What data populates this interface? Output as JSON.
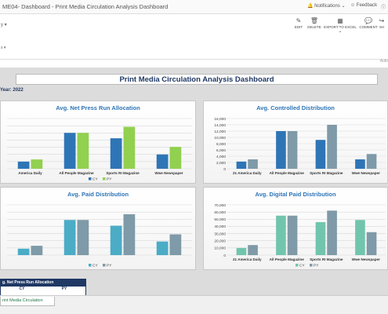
{
  "window": {
    "title": "ME04- Dashboard - Print Media Circulation Analysis Dashboard",
    "notifications": "Notifications",
    "feedback": "Feedback"
  },
  "toolbar": {
    "edit": "EDIT",
    "delete": "DELETE",
    "export": "EXPORT TO EXCEL",
    "comment": "COMMENT",
    "share": "SH",
    "select_left": "y",
    "select_left2": "s",
    "auto": "Auto"
  },
  "dashboard": {
    "title": "Print Media Circulation Analysis Dashboard",
    "year_label": "Year:",
    "year_value": "2022"
  },
  "colors": {
    "banner_text": "#1f3864",
    "panel_title": "#2e75b6",
    "gray_bg": "#dcdcdc"
  },
  "chart_data": [
    {
      "type": "bar",
      "title": "Avg. Net Press Run Allocation",
      "categories": [
        "America Daily",
        "All People Magazine",
        "Sports RI Magazine",
        "Wwe Newspaper"
      ],
      "series": [
        {
          "name": "CY",
          "color": "#2e75b6",
          "values": [
            2,
            10,
            8.5,
            4
          ]
        },
        {
          "name": "PY",
          "color": "#92d050",
          "values": [
            2.6,
            10,
            11.7,
            6.1
          ]
        }
      ],
      "ylim": [
        0,
        14
      ],
      "show_y_axis": false,
      "legend": "bottom"
    },
    {
      "type": "bar",
      "title": "Avg. Controlled Distribution",
      "categories": [
        "21 America Daily",
        "All People Magazine",
        "Sports RI Magazine",
        "Wwe Newspaper"
      ],
      "series": [
        {
          "name": "CY",
          "color": "#2e75b6",
          "values": [
            2300,
            12000,
            9200,
            3000
          ]
        },
        {
          "name": "PY",
          "color": "#7f9aa8",
          "values": [
            3000,
            12000,
            14000,
            4700
          ]
        }
      ],
      "ylim": [
        0,
        16000
      ],
      "yticks": [
        "0",
        "2,000",
        "4,000",
        "6,000",
        "8,000",
        "10,000",
        "12,000",
        "14,000",
        "16,000"
      ],
      "show_y_axis": true,
      "legend": "none"
    },
    {
      "type": "bar",
      "title": "Avg. Paid Distribution",
      "categories": [
        "",
        "",
        "",
        ""
      ],
      "series": [
        {
          "name": "CY",
          "color": "#4bacc6",
          "values": [
            900,
            4900,
            4100,
            1900
          ]
        },
        {
          "name": "PY",
          "color": "#7f9aa8",
          "values": [
            1300,
            4900,
            5700,
            2900
          ]
        }
      ],
      "ylim": [
        0,
        7000
      ],
      "show_y_axis": false,
      "legend": "bottom"
    },
    {
      "type": "bar",
      "title": "Avg. Digital Paid Distribution",
      "categories": [
        "21 America Daily",
        "All People Magazine",
        "Sports RI Magazine",
        "Wwe Newspaper"
      ],
      "series": [
        {
          "name": "CY",
          "color": "#72c5ad",
          "values": [
            10000,
            55000,
            46000,
            49000
          ]
        },
        {
          "name": "PY",
          "color": "#7f9aa8",
          "values": [
            14000,
            55000,
            62000,
            32000
          ]
        }
      ],
      "ylim": [
        0,
        70000
      ],
      "yticks": [
        "0",
        "10,000",
        "20,000",
        "30,000",
        "40,000",
        "50,000",
        "60,000",
        "70,000"
      ],
      "show_y_axis": true,
      "legend": "bottom"
    }
  ],
  "bottom_card": {
    "title": "g. Net Press Run Allocation",
    "col1": "CY",
    "col2": "PY"
  },
  "sheet": {
    "tab": "rint Media Circulation"
  }
}
